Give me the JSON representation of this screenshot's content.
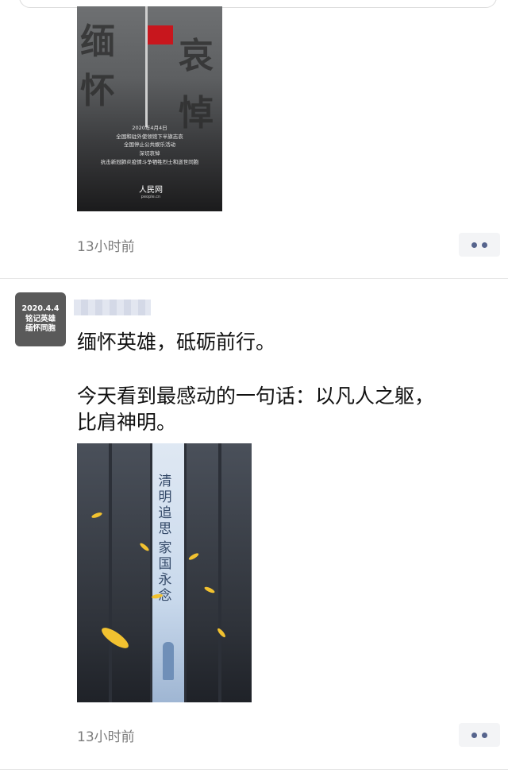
{
  "post1": {
    "poster": {
      "big_chars_left": [
        "缅",
        "怀"
      ],
      "big_chars_right": [
        "哀",
        "悼"
      ],
      "caption_lines": [
        "2020年4月4日",
        "全国和驻外使领馆下半旗志哀",
        "全国停止公共娱乐活动",
        "深切哀悼",
        "抗击新冠肺炎疫情斗争牺牲烈士和逝世同胞"
      ],
      "logo_text": "人民网",
      "logo_url": "people.cn"
    },
    "timestamp": "13小时前"
  },
  "post2": {
    "avatar_lines": [
      "2020.4.4",
      "铭记英雄",
      "缅怀同胞"
    ],
    "text_lines": [
      "缅怀英雄，砥砺前行。",
      "今天看到最感动的一句话：以凡人之躯，",
      "比肩神明。"
    ],
    "poster": {
      "line1": "清明追思",
      "line2": "家国永念"
    },
    "timestamp": "13小时前"
  },
  "colors": {
    "more_dot": "#56648d",
    "timestamp": "#7b7b7b",
    "flag": "#c8161d"
  },
  "icons": {
    "more": "more-dots-icon"
  }
}
